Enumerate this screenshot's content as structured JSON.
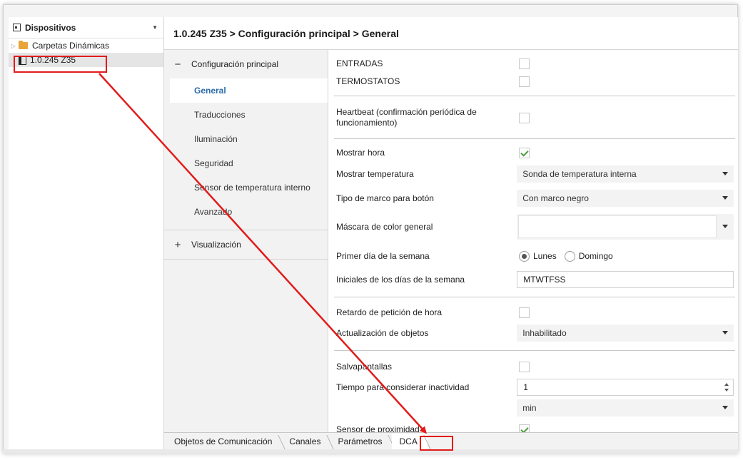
{
  "tree": {
    "header_label": "Dispositivos",
    "items": [
      {
        "label": "Carpetas Dinámicas"
      },
      {
        "label": "1.0.245 Z35"
      }
    ]
  },
  "breadcrumb": "1.0.245 Z35 > Configuración principal > General",
  "nav": {
    "group1_sign": "−",
    "group1_label": "Configuración principal",
    "items": [
      {
        "label": "General"
      },
      {
        "label": "Traducciones"
      },
      {
        "label": "Iluminación"
      },
      {
        "label": "Seguridad"
      },
      {
        "label": "Sensor de temperatura interno"
      },
      {
        "label": "Avanzado"
      }
    ],
    "group2_sign": "+",
    "group2_label": "Visualización"
  },
  "params": {
    "entradas": {
      "label": "ENTRADAS",
      "checked": false
    },
    "termostatos": {
      "label": "TERMOSTATOS",
      "checked": false
    },
    "heartbeat": {
      "label": "Heartbeat (confirmación periódica de funcionamiento)",
      "checked": false
    },
    "mostrar_hora": {
      "label": "Mostrar hora",
      "checked": true
    },
    "mostrar_temperatura": {
      "label": "Mostrar temperatura",
      "value": "Sonda de temperatura interna"
    },
    "tipo_marco": {
      "label": "Tipo de marco para botón",
      "value": "Con marco negro"
    },
    "mascara_color": {
      "label": "Máscara de color general",
      "value": ""
    },
    "primer_dia": {
      "label": "Primer día de la semana",
      "options": [
        "Lunes",
        "Domingo"
      ],
      "selected": "Lunes"
    },
    "iniciales": {
      "label": "Iniciales de los días de la semana",
      "value": "MTWTFSS"
    },
    "retardo": {
      "label": "Retardo de petición de hora",
      "checked": false
    },
    "actualizacion": {
      "label": "Actualización de objetos",
      "value": "Inhabilitado"
    },
    "salvapantallas": {
      "label": "Salvapantallas",
      "checked": false
    },
    "tiempo_inactividad": {
      "label": "Tiempo para considerar inactividad",
      "value": "1",
      "unit": "min"
    },
    "sensor_proximidad": {
      "label": "Sensor de proximidad",
      "checked": true
    }
  },
  "tabs": [
    {
      "label": "Objetos de Comunicación"
    },
    {
      "label": "Canales"
    },
    {
      "label": "Parámetros"
    },
    {
      "label": "DCA"
    }
  ],
  "colors": {
    "annotation": "#e21b1b",
    "active_nav": "#2b6aa8",
    "check": "#4a9d3c"
  }
}
